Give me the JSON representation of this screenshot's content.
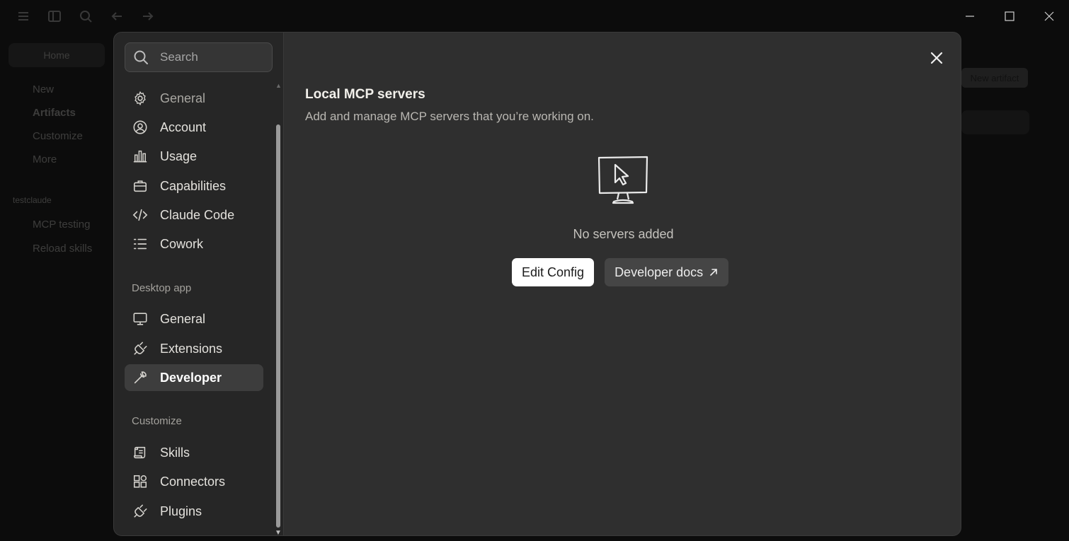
{
  "background_sidebar": {
    "home_label": "Home",
    "items": [
      {
        "label": "New"
      },
      {
        "label": "Artifacts"
      },
      {
        "label": "Customize"
      },
      {
        "label": "More"
      },
      {
        "label": "testclaude"
      },
      {
        "label": "MCP testing"
      },
      {
        "label": "Reload skills"
      }
    ]
  },
  "background_right": {
    "chip_label": "New artifact"
  },
  "settings": {
    "search": {
      "placeholder": "Search",
      "value": ""
    },
    "nav_primary": [
      {
        "label": "General",
        "icon": "gear-icon"
      },
      {
        "label": "Account",
        "icon": "account-icon"
      },
      {
        "label": "Usage",
        "icon": "bar-chart-icon"
      },
      {
        "label": "Capabilities",
        "icon": "briefcase-icon"
      },
      {
        "label": "Claude Code",
        "icon": "code-icon"
      },
      {
        "label": "Cowork",
        "icon": "checklist-icon"
      }
    ],
    "desktop_app_label": "Desktop app",
    "nav_desktop": [
      {
        "label": "General",
        "icon": "monitor-icon"
      },
      {
        "label": "Extensions",
        "icon": "plug-icon"
      },
      {
        "label": "Developer",
        "icon": "wrench-icon",
        "active": true
      }
    ],
    "customize_label": "Customize",
    "nav_customize": [
      {
        "label": "Skills",
        "icon": "scroll-icon"
      },
      {
        "label": "Connectors",
        "icon": "connectors-icon"
      },
      {
        "label": "Plugins",
        "icon": "plug-icon"
      }
    ]
  },
  "content": {
    "title": "Local MCP servers",
    "subtitle": "Add and manage MCP servers that you’re working on.",
    "empty_icon": "monitor-cursor-icon",
    "empty_text": "No servers added",
    "edit_config_label": "Edit Config",
    "developer_docs_label": "Developer docs"
  },
  "colors": {
    "modal_bg": "#2f2f2f",
    "sidebar_bg": "#262626",
    "active_item_bg": "#3d3d3d",
    "primary_button_bg": "#ffffff",
    "secondary_button_bg": "#454545"
  }
}
